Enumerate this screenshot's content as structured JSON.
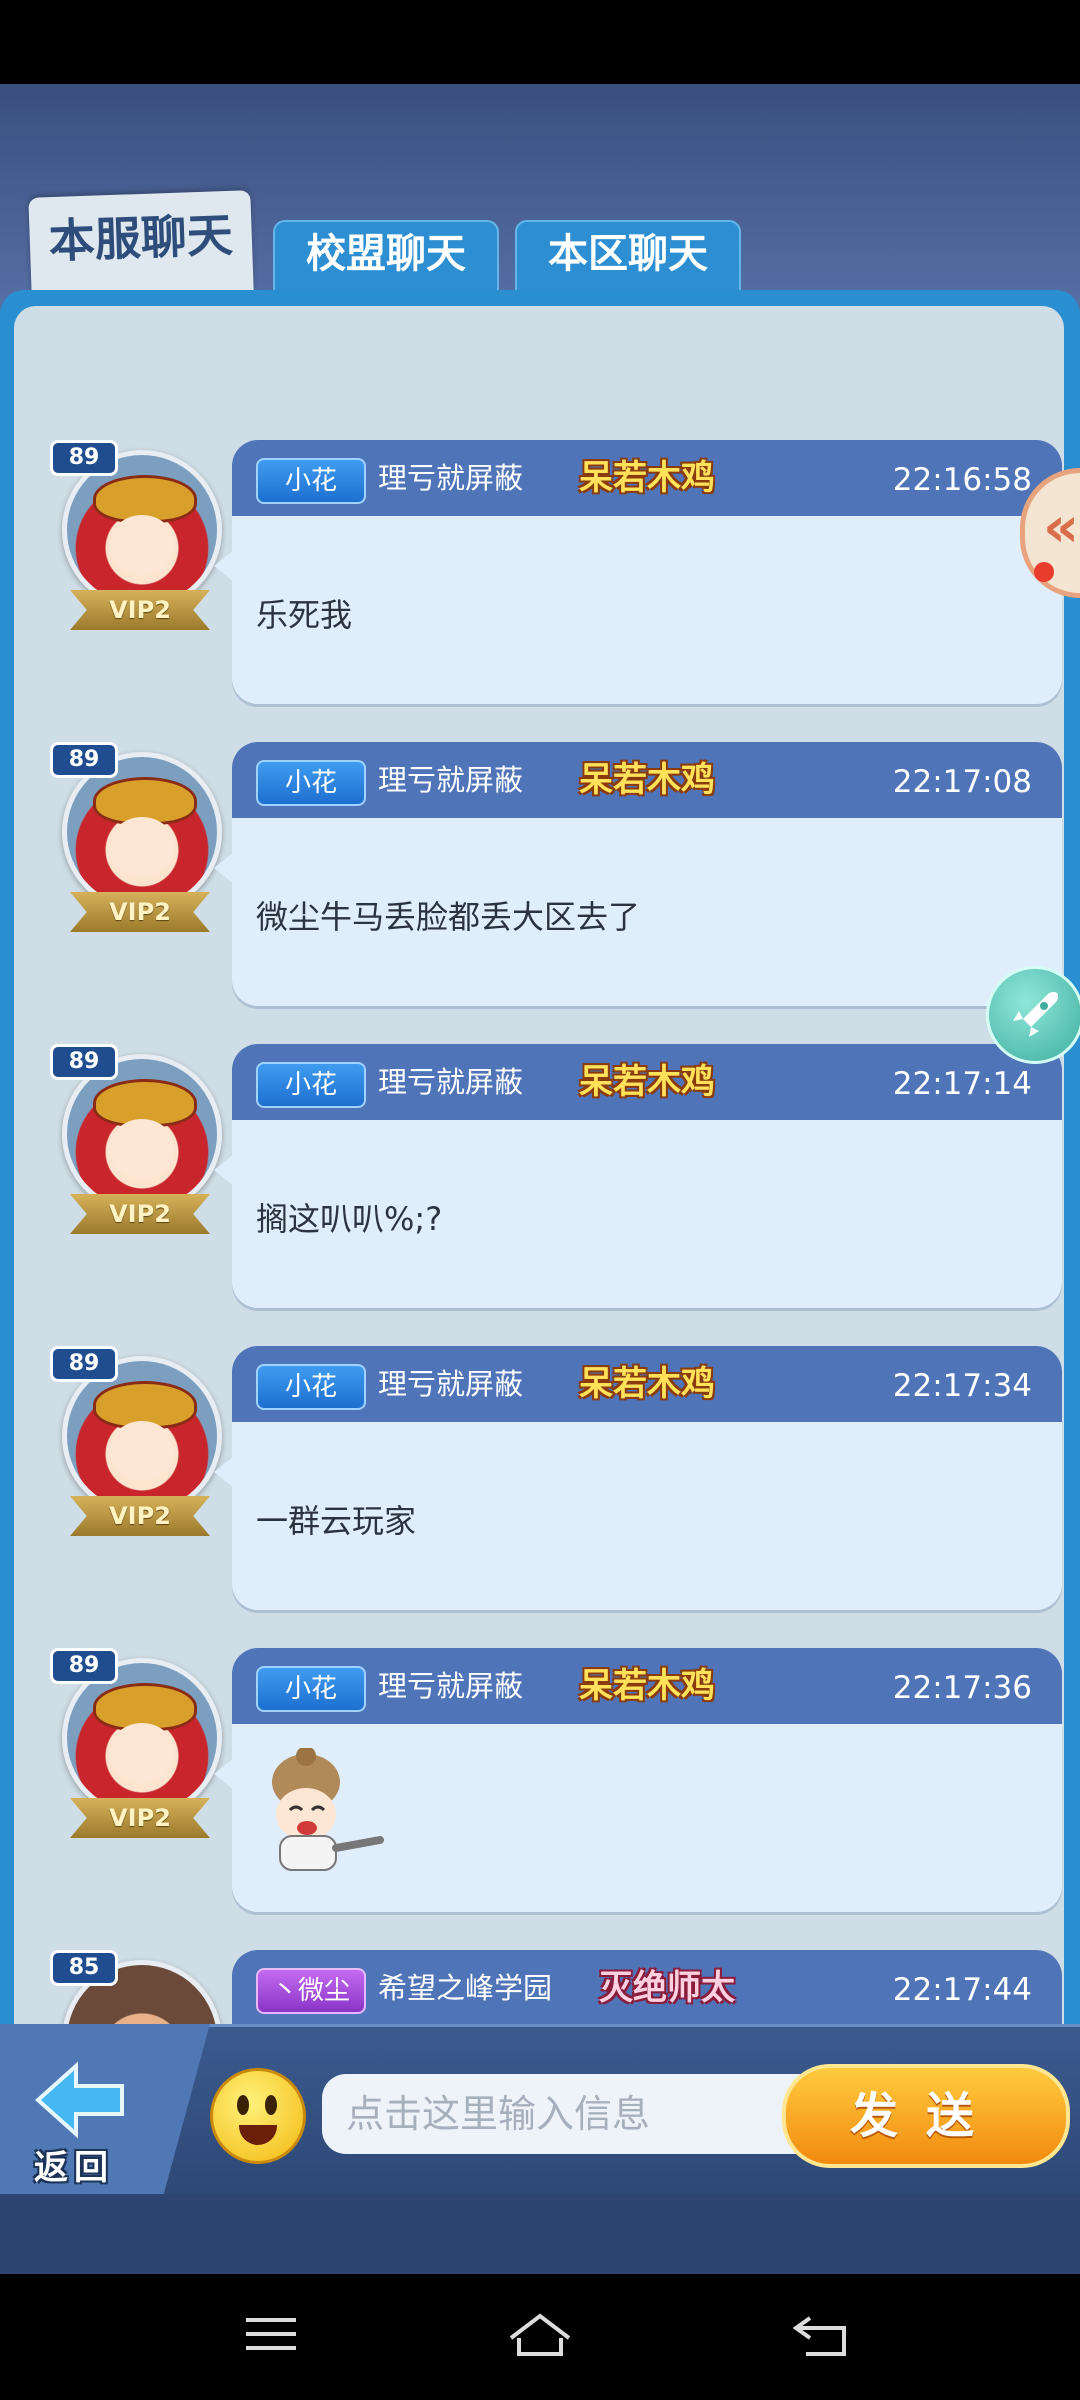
{
  "tabs": [
    {
      "label": "本服聊天",
      "active": true
    },
    {
      "label": "校盟聊天",
      "active": false
    },
    {
      "label": "本区聊天",
      "active": false
    }
  ],
  "messages": [
    {
      "level": "89",
      "vip": "VIP2",
      "tag": "小花",
      "name": "理亏就屏蔽",
      "badge": "呆若木鸡",
      "time": "22:16:58",
      "text": "乐死我"
    },
    {
      "level": "89",
      "vip": "VIP2",
      "tag": "小花",
      "name": "理亏就屏蔽",
      "badge": "呆若木鸡",
      "time": "22:17:08",
      "text": "微尘牛马丢脸都丢大区去了"
    },
    {
      "level": "89",
      "vip": "VIP2",
      "tag": "小花",
      "name": "理亏就屏蔽",
      "badge": "呆若木鸡",
      "time": "22:17:14",
      "text": "搁这叭叭%;?"
    },
    {
      "level": "89",
      "vip": "VIP2",
      "tag": "小花",
      "name": "理亏就屏蔽",
      "badge": "呆若木鸡",
      "time": "22:17:34",
      "text": "一群云玩家"
    },
    {
      "level": "89",
      "vip": "VIP2",
      "tag": "小花",
      "name": "理亏就屏蔽",
      "badge": "呆若木鸡",
      "time": "22:17:36",
      "text": ""
    },
    {
      "level": "85",
      "vip": "",
      "tag": "丶微尘",
      "name": "希望之峰学园",
      "badge": "灭绝师太",
      "time": "22:17:44",
      "text": ""
    }
  ],
  "side": {
    "collapse_glyph": "«"
  },
  "bottom": {
    "back_label": "返回",
    "input_placeholder": "点击这里输入信息",
    "send_label": "发送"
  }
}
